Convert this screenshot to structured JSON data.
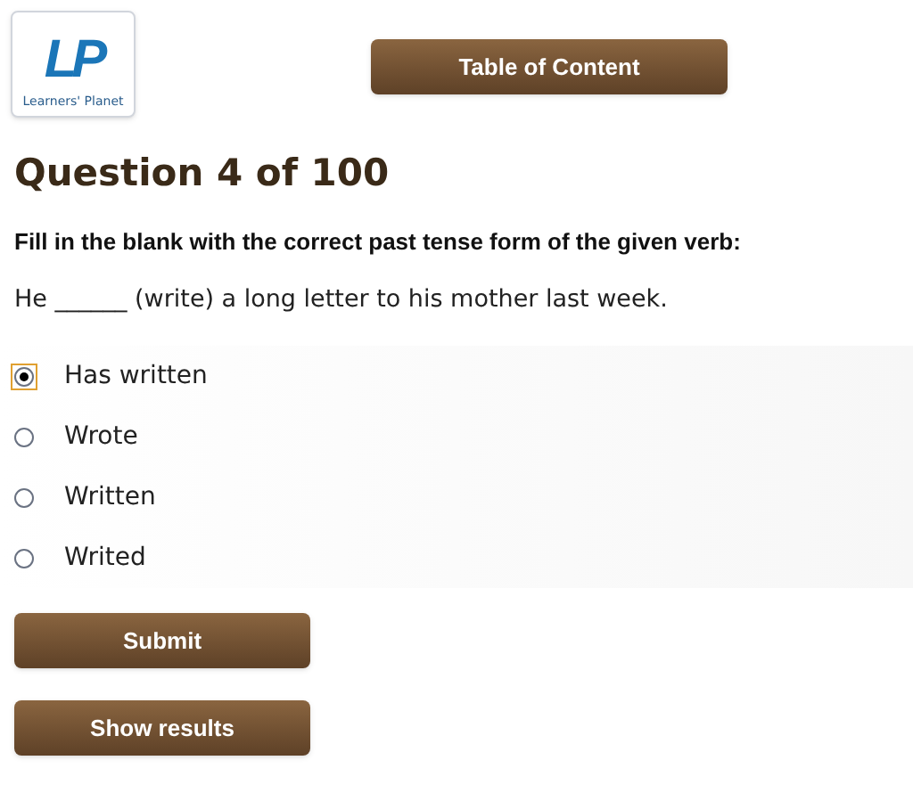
{
  "logo": {
    "mark": "LP",
    "caption": "Learners' Planet"
  },
  "toc_button": "Table of Content",
  "heading": "Question 4 of 100",
  "instruction": "Fill in the blank with the correct past tense form of the given verb:",
  "sentence": "He ______ (write) a long letter to his mother last week.",
  "options": [
    {
      "label": "Has written",
      "selected": true
    },
    {
      "label": "Wrote",
      "selected": false
    },
    {
      "label": "Written",
      "selected": false
    },
    {
      "label": "Writed",
      "selected": false
    }
  ],
  "buttons": [
    "Submit",
    "Show results"
  ]
}
